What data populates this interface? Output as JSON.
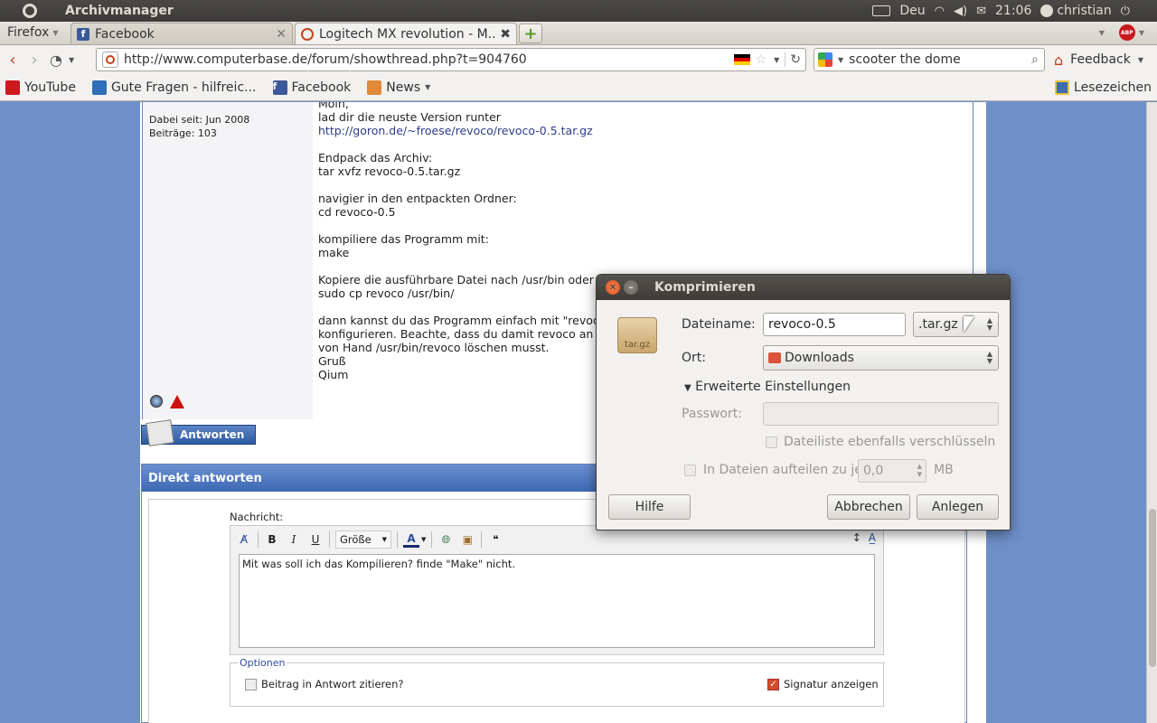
{
  "panel": {
    "app_title": "Archivmanager",
    "keyboard": "Deu",
    "time": "21:06",
    "user": "christian"
  },
  "browser": {
    "menu_label": "Firefox",
    "tabs": [
      {
        "label": "Facebook",
        "icon": "facebook-icon",
        "active": false
      },
      {
        "label": "Logitech MX revolution - M...",
        "icon": "computerbase-icon",
        "active": true
      }
    ],
    "url": "http://www.computerbase.de/forum/showthread.php?t=904760",
    "search_text": "scooter the dome",
    "feedback_label": "Feedback",
    "bookmarks": [
      {
        "label": "YouTube",
        "icon": "youtube-icon"
      },
      {
        "label": "Gute Fragen - hilfreic...",
        "icon": "gutefrage-icon"
      },
      {
        "label": "Facebook",
        "icon": "facebook-icon"
      },
      {
        "label": "News",
        "icon": "folder-icon"
      }
    ],
    "bookmarks_right": "Lesezeichen"
  },
  "post": {
    "member_since": "Dabei seit: Jun 2008",
    "posts_count": "Beiträge: 103",
    "lines": [
      "Moin,",
      "lad dir die neuste Version runter",
      "http://goron.de/~froese/revoco/revoco-0.5.tar.gz",
      "",
      "Endpack das Archiv:",
      "tar xvfz revoco-0.5.tar.gz",
      "",
      "navigier in den entpackten Ordner:",
      "cd revoco-0.5",
      "",
      "kompiliere das Programm mit:",
      "make",
      "",
      "Kopiere die ausführbare Datei nach /usr/bin oder w",
      "sudo cp revoco /usr/bin/",
      "",
      "dann kannst du das Programm einfach mit \"revoco",
      "konfigurieren. Beachte, dass du damit revoco an d",
      "von Hand /usr/bin/revoco löschen musst.",
      "Gruß",
      "Qium"
    ]
  },
  "reply_button": "Antworten",
  "quick_reply": {
    "title": "Direkt antworten",
    "message_label": "Nachricht:",
    "size_label": "Größe",
    "message_text": "Mit was soll ich das Kompilieren? finde \"Make\" nicht.",
    "options_legend": "Optionen",
    "quote_option": "Beitrag in Antwort zitieren?",
    "signature_option": "Signatur anzeigen"
  },
  "dialog": {
    "title": "Komprimieren",
    "filename_label": "Dateiname:",
    "filename_value": "revoco-0.5",
    "extension": ".tar.gz",
    "location_label": "Ort:",
    "location_value": "Downloads",
    "advanced_label": "Erweiterte Einstellungen",
    "password_label": "Passwort:",
    "encrypt_list_label": "Dateiliste ebenfalls verschlüsseln",
    "split_label": "In Dateien aufteilen zu je",
    "split_value": "0,0",
    "split_unit": "MB",
    "archive_icon_text": "tar.gz",
    "help_button": "Hilfe",
    "cancel_button": "Abbrechen",
    "create_button": "Anlegen"
  }
}
